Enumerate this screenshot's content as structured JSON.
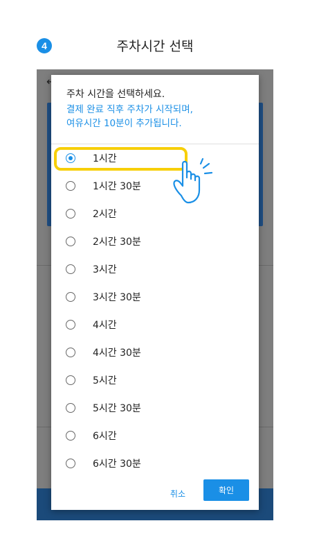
{
  "step": {
    "number": "4",
    "title": "주차시간 선택"
  },
  "dialog": {
    "instruction": "주차 시간을 선택하세요.",
    "notice_line1": "결제 완료 직후 주차가 시작되며,",
    "notice_line2": "여유시간 10분이 추가됩니다.",
    "options": [
      {
        "label": "1시간",
        "selected": true
      },
      {
        "label": "1시간 30분",
        "selected": false
      },
      {
        "label": "2시간",
        "selected": false
      },
      {
        "label": "2시간 30분",
        "selected": false
      },
      {
        "label": "3시간",
        "selected": false
      },
      {
        "label": "3시간 30분",
        "selected": false
      },
      {
        "label": "4시간",
        "selected": false
      },
      {
        "label": "4시간 30분",
        "selected": false
      },
      {
        "label": "5시간",
        "selected": false
      },
      {
        "label": "5시간 30분",
        "selected": false
      },
      {
        "label": "6시간",
        "selected": false
      },
      {
        "label": "6시간 30분",
        "selected": false
      }
    ],
    "cancel_label": "취소",
    "confirm_label": "확인"
  },
  "colors": {
    "accent": "#1a8fe6",
    "highlight": "#f7cf08"
  },
  "icons": {
    "pointer": "tap-hand-icon"
  }
}
